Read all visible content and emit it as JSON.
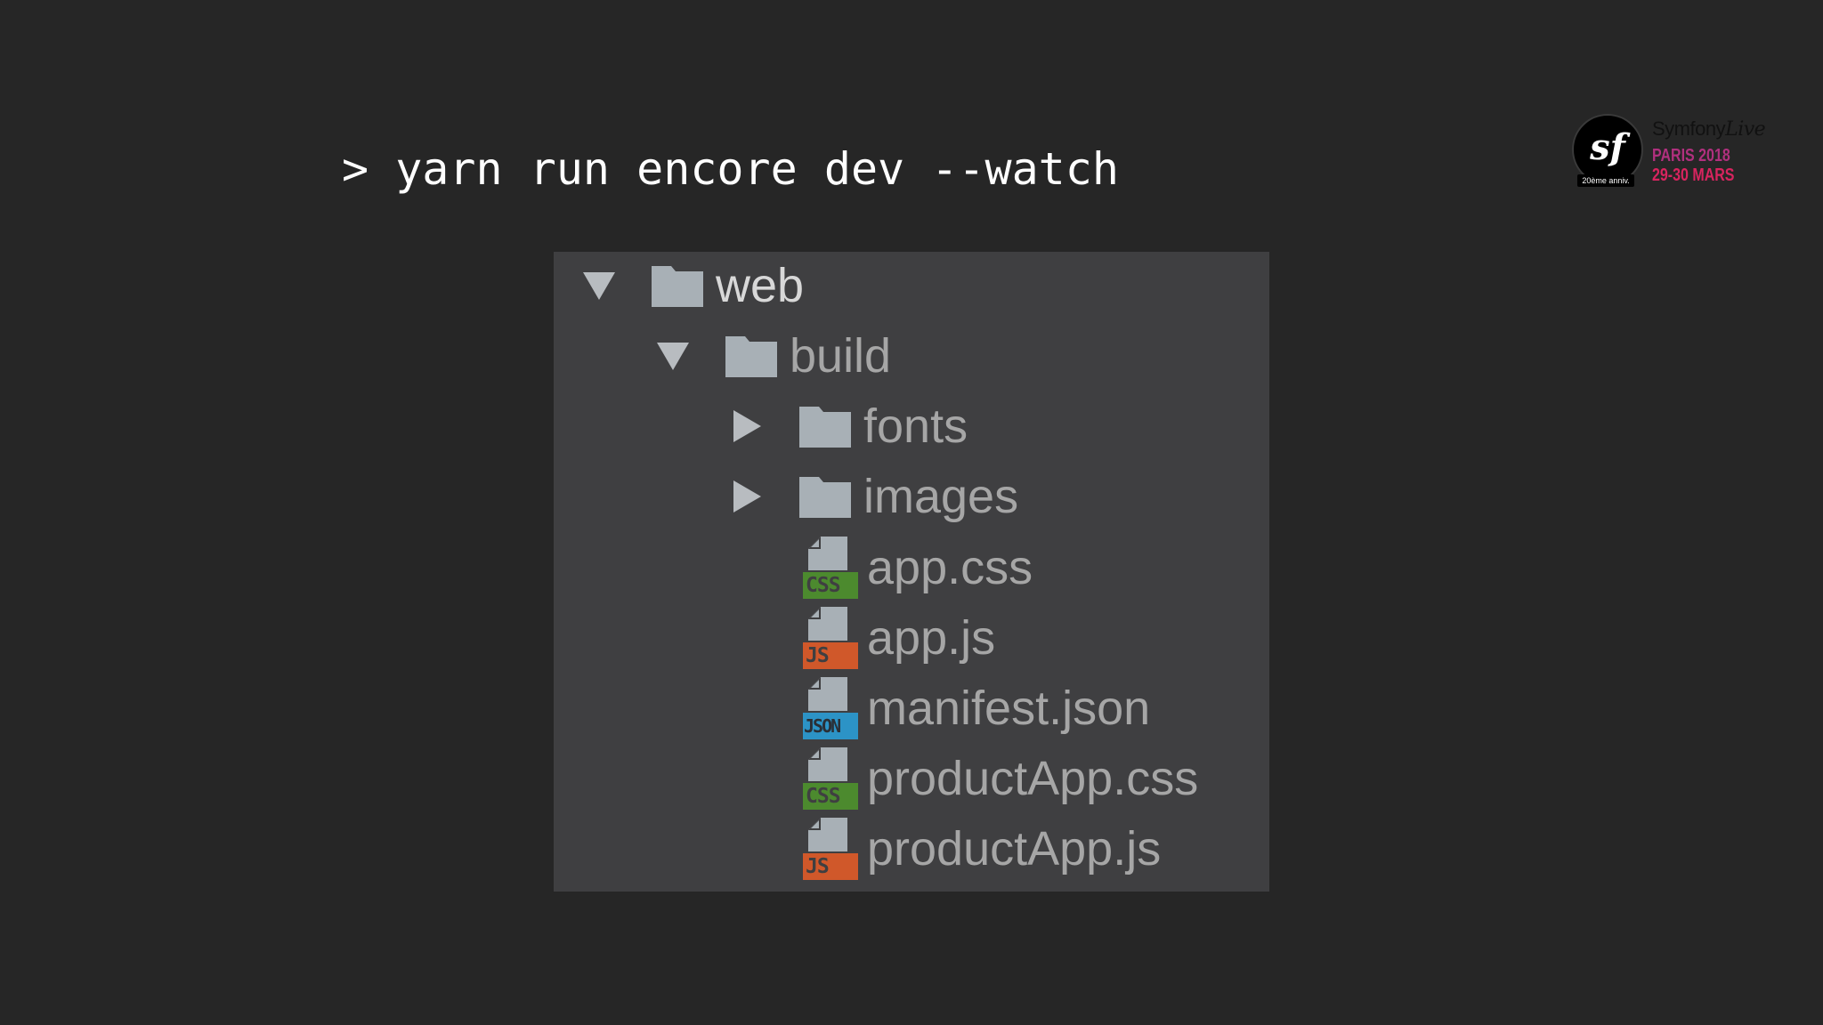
{
  "command": "> yarn run encore dev --watch",
  "logo": {
    "monogram": "sf",
    "ribbon": "20ème anniv.",
    "brand": "Symfony",
    "brand_suffix": "Live",
    "line1": "PARIS 2018",
    "line2": "29-30 MARS"
  },
  "tree": {
    "items": [
      {
        "label": "web",
        "icon": "folder-icon",
        "state": "expanded"
      },
      {
        "label": "build",
        "icon": "folder-icon",
        "state": "expanded"
      },
      {
        "label": "fonts",
        "icon": "folder-icon",
        "state": "collapsed"
      },
      {
        "label": "images",
        "icon": "folder-icon",
        "state": "collapsed"
      },
      {
        "label": "app.css",
        "icon": "css-file-icon",
        "badge": "CSS",
        "badge_color": "#4c8a2e"
      },
      {
        "label": "app.js",
        "icon": "js-file-icon",
        "badge": "JS",
        "badge_color": "#d0582a"
      },
      {
        "label": "manifest.json",
        "icon": "json-file-icon",
        "badge": "JSON",
        "badge_color": "#2c93c6"
      },
      {
        "label": "productApp.css",
        "icon": "css-file-icon",
        "badge": "CSS",
        "badge_color": "#4c8a2e"
      },
      {
        "label": "productApp.js",
        "icon": "js-file-icon",
        "badge": "JS",
        "badge_color": "#d0582a"
      }
    ]
  },
  "colors": {
    "background": "#262626",
    "panel": "#3f3f41",
    "icon_gray": "#a8b0b6"
  }
}
